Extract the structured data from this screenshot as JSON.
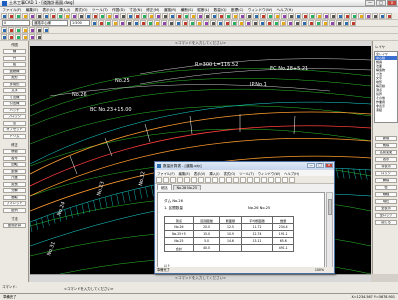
{
  "window": {
    "title": "土木工事CAD 1 - [道路計画図.dwg]",
    "buttons": [
      "—",
      "□",
      "×"
    ]
  },
  "menubar": [
    "ファイル(F)",
    "編集(E)",
    "表示(V)",
    "挿入(I)",
    "書式(O)",
    "ツール(T)",
    "作図(D)",
    "寸法(N)",
    "修正(M)",
    "道路(R)",
    "横断(S)",
    "縦断(L)",
    "数量(Q)",
    "座標(C)",
    "ウィンドウ(W)",
    "ヘルプ(H)"
  ],
  "toolbar": {
    "layer_combo": "0",
    "style_combo": "道路中心線",
    "scale_combo": "1:500"
  },
  "left_panel": {
    "headers": [
      "作図",
      "修正",
      "寸法"
    ],
    "buttons_top": [
      "線",
      "円",
      "弧",
      "連続線",
      "矩形",
      "多角形",
      "文字",
      "寸法線",
      "引出線",
      "ハッチ",
      "ブロック",
      "点",
      "オフセット",
      "トリム"
    ],
    "buttons_mid": [
      "移動",
      "複写",
      "回転",
      "鏡像",
      "尺度",
      "延長",
      "分解",
      "面取",
      "フィレット",
      "配列"
    ],
    "buttons_bottom": [
      "座標計算"
    ]
  },
  "canvas": {
    "header": "<コマンドを入力してください>",
    "labels": [
      {
        "text": "No.26",
        "color": "#ffffff"
      },
      {
        "text": "No.25",
        "color": "#ffffff"
      },
      {
        "text": "No.24",
        "color": "#ffffff"
      },
      {
        "text": "No.23",
        "color": "#ffffff"
      },
      {
        "text": "BC No.23+15.00",
        "color": "#ffffff"
      },
      {
        "text": "IP.No.1",
        "color": "#ffffff"
      },
      {
        "text": "R=300  L=116.52",
        "color": "#ffffff"
      },
      {
        "text": "EC No.28+5.21",
        "color": "#ffffff"
      },
      {
        "text": "No.31",
        "color": "#ffffff"
      },
      {
        "text": "No.32",
        "color": "#ffffff"
      }
    ]
  },
  "command_bar": "<コマンドを入力してください>",
  "right_panel": {
    "title": "レイヤ",
    "tree": [
      "全レイヤ",
      "中心線",
      "幅員",
      "法面",
      "構造物",
      "寸法",
      "文字",
      "地形",
      "等高線",
      "測点",
      "境界",
      "その他",
      "作業用",
      "非表示",
      "凍結"
    ],
    "selected": 1,
    "buttons": [
      "新規",
      "削除",
      "名前変更",
      "表示",
      "非表示",
      "ロック",
      "解除",
      "色",
      "線種",
      "現在",
      "全表示",
      "全ロック",
      "閉じる"
    ]
  },
  "dialog": {
    "title": "数量計算書 - [道路.qty]",
    "menu": [
      "ファイル(F)",
      "編集(E)",
      "表示(V)",
      "挿入(I)",
      "書式(O)",
      "ツール(T)",
      "ウィンドウ(W)",
      "ヘルプ(H)"
    ],
    "tabs": [
      "総括",
      "No.26 No.25"
    ],
    "doc": {
      "heading": "ダム No.26",
      "left_title": "1. 区間数量",
      "right_title": "No.26 No.25",
      "columns": [
        "測点",
        "区間距離",
        "断面積",
        "平均断面積",
        "数量"
      ],
      "rows": [
        [
          "No.26",
          "20.0",
          "12.5",
          "11.72",
          "234.4"
        ],
        [
          "No.25+5",
          "15.0",
          "10.9",
          "12.74",
          "191.1"
        ],
        [
          "No.25",
          "5.0",
          "14.6",
          "13.11",
          "65.6"
        ],
        [
          "合計",
          "40.0",
          "",
          "",
          "491.1"
        ]
      ],
      "footer": "以上"
    },
    "status_left": "準備完了",
    "zoom": "100%"
  },
  "bottom": {
    "command_label": "コマンド:",
    "mid_label": "<コマンドを入力してください>"
  },
  "statusbar": {
    "left": "準備完了",
    "right": "X=1234.567  Y=5678.901"
  },
  "colors": {
    "canvas_bg": "#000000",
    "center_line": "#ff3c3c",
    "cyan": "#18e0e0",
    "green": "#2bc02b",
    "orange": "#ff9a2e",
    "white": "#ffffff"
  }
}
